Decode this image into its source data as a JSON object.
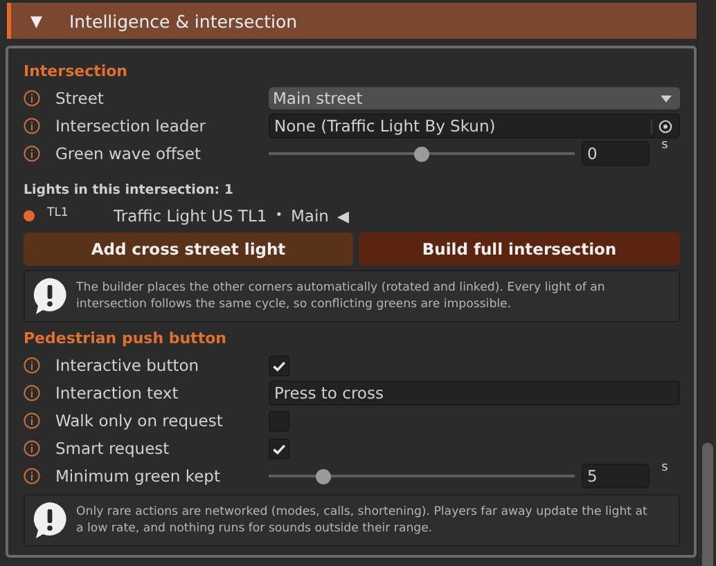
{
  "header": {
    "toggle": "▼",
    "title": "Intelligence & intersection"
  },
  "intersection": {
    "title": "Intersection",
    "rows": [
      {
        "kind": "dropdown",
        "label": "Street",
        "value": "Main street"
      },
      {
        "kind": "object",
        "label": "Intersection leader",
        "value": "None (Traffic Light By Skun)"
      },
      {
        "kind": "slider",
        "label": "Green wave offset",
        "level": 0.5,
        "value": "0",
        "unit": "s"
      }
    ]
  },
  "lights": {
    "title": "Lights in this intersection: 1",
    "items": [
      {
        "color": "#e8672a",
        "id": "TL1",
        "name": "Traffic Light US TL1",
        "separator": "•",
        "street": "Main",
        "marker": "◀"
      }
    ]
  },
  "buttons": [
    {
      "label": "Add cross street light",
      "kind": "secondary"
    },
    {
      "label": "Build full intersection",
      "kind": "primary"
    }
  ],
  "intersection_help": "The builder places the other corners automatically (rotated and linked). Every light of an intersection follows the same cycle, so conflicting greens are impossible.",
  "pedestrian": {
    "title": "Pedestrian push button",
    "rows": [
      {
        "kind": "checkbox",
        "label": "Interactive button",
        "checked": true
      },
      {
        "kind": "text",
        "label": "Interaction text",
        "value": "Press to cross"
      },
      {
        "kind": "checkbox",
        "label": "Walk only on request",
        "checked": false
      },
      {
        "kind": "checkbox",
        "label": "Smart request",
        "checked": true
      },
      {
        "kind": "slider",
        "label": "Minimum green kept",
        "level": 0.18,
        "value": "5",
        "unit": "s"
      }
    ]
  },
  "pedestrian_help": "Only rare actions are networked (modes, calls, shortening). Players far away update the light at a low rate, and nothing runs for sounds outside their range."
}
